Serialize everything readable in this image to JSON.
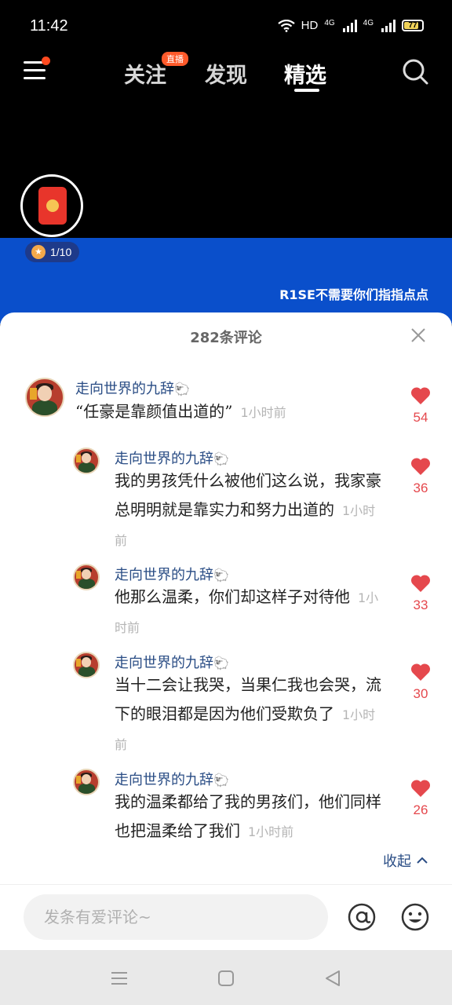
{
  "status_bar": {
    "time": "11:42",
    "hd_label": "HD",
    "net1": "4G",
    "net2": "4G",
    "battery": "77",
    "battery_color": "#f0d35a"
  },
  "top_nav": {
    "tabs": [
      {
        "label": "关注"
      },
      {
        "label": "发现"
      },
      {
        "label": "精选"
      }
    ],
    "live_badge": "直播",
    "active_tab": "精选"
  },
  "video": {
    "progress": "1/10",
    "caption": "R1SE不需要你们指指点点",
    "background_color": "#0a4fcb"
  },
  "comments_sheet": {
    "title": "282条评论",
    "comments": [
      {
        "username": "走向世界的九辞",
        "text": "“任豪是靠颜值出道的”",
        "time": "1小时前",
        "likes": "54"
      },
      {
        "username": "走向世界的九辞",
        "text": "我的男孩凭什么被他们这么说，我家豪总明明就是靠实力和努力出道的",
        "time": "1小时前",
        "likes": "36"
      },
      {
        "username": "走向世界的九辞",
        "text": "他那么温柔，你们却这样子对待他",
        "time": "1小时前",
        "likes": "33"
      },
      {
        "username": "走向世界的九辞",
        "text": "当十二会让我哭，当果仁我也会哭，流下的眼泪都是因为他们受欺负了",
        "time": "1小时前",
        "likes": "30"
      },
      {
        "username": "走向世界的九辞",
        "text": "我的温柔都给了我的男孩们，他们同样也把温柔给了我们",
        "time": "1小时前",
        "likes": "26"
      }
    ],
    "collapse_label": "收起"
  },
  "input_bar": {
    "placeholder": "发条有爱评论~"
  },
  "colors": {
    "accent": "#e5484d",
    "username": "#2a4d85",
    "badge": "#ff5a2b"
  },
  "icons": [
    "menu-icon",
    "search-icon",
    "close-icon",
    "heart-icon",
    "sheep-icon",
    "at-icon",
    "emoji-icon",
    "chevron-up-icon",
    "star-icon",
    "red-envelope-icon"
  ]
}
